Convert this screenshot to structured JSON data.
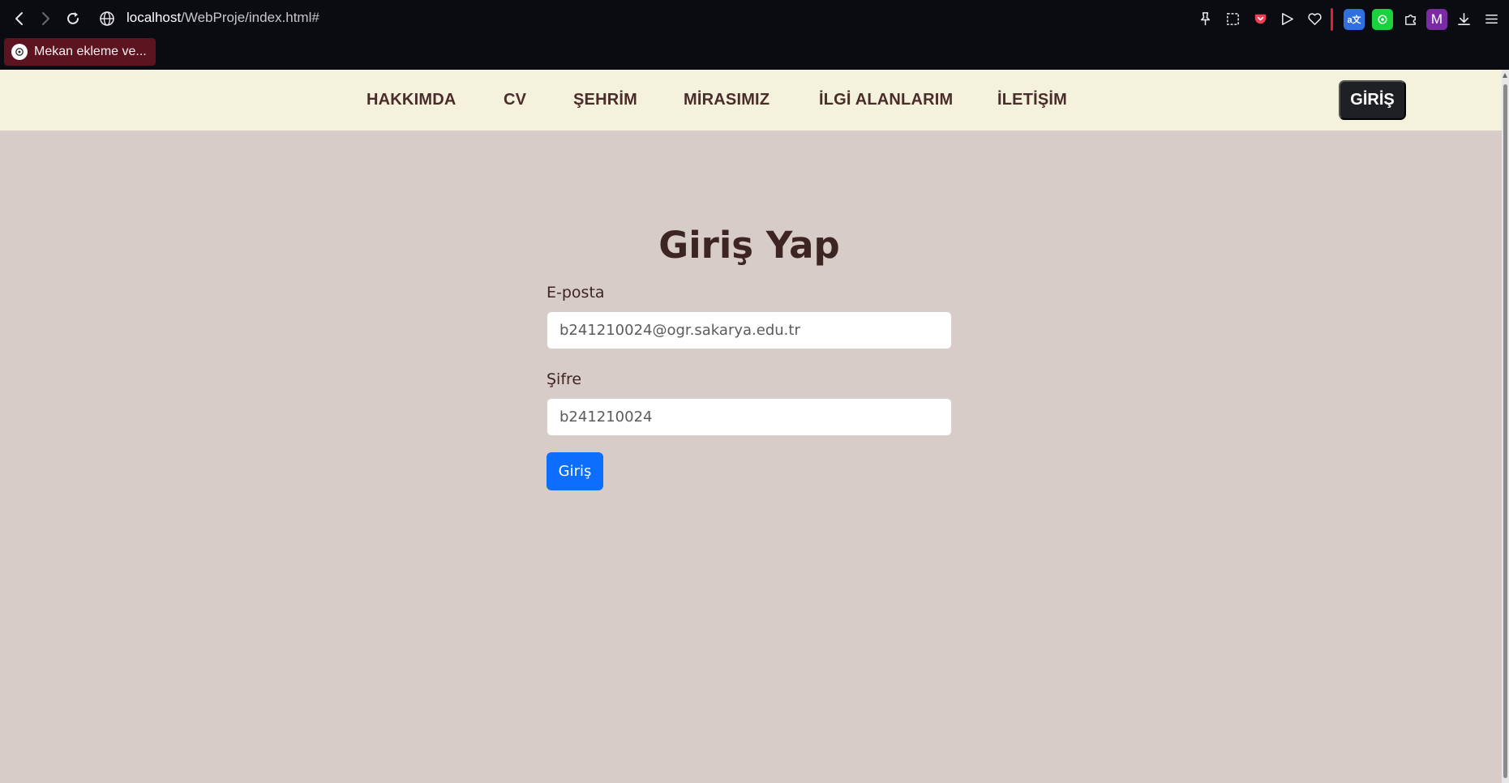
{
  "browser": {
    "url_host": "localhost",
    "url_path": "/WebProje/index.html#",
    "tab_label": "Mekan ekleme ve...",
    "profile_initial": "M",
    "icons": [
      "back-arrow-icon",
      "forward-arrow-icon",
      "reload-icon",
      "globe-icon",
      "pin-icon",
      "screenshot-icon",
      "pocket-icon",
      "send-icon",
      "heart-icon",
      "translate-icon",
      "chatgpt-icon",
      "extensions-icon",
      "profile-icon",
      "download-icon",
      "menu-icon"
    ]
  },
  "navbar": {
    "links": [
      "HAKKIMDA",
      "CV",
      "ŞEHRİM",
      "MİRASIMIZ",
      "İLGİ ALANLARIM",
      "İLETİŞİM"
    ],
    "login_button": "GİRİŞ"
  },
  "login_form": {
    "title": "Giriş Yap",
    "email_label": "E-posta",
    "email_value": "b241210024@ogr.sakarya.edu.tr",
    "password_label": "Şifre",
    "password_value": "b241210024",
    "submit_label": "Giriş"
  },
  "colors": {
    "page_background": "#d8ccc8",
    "navbar_background": "#f4f2dc",
    "nav_text": "#4a2c2a",
    "primary_button": "#0d6efd",
    "dark_button": "#1f2024"
  }
}
